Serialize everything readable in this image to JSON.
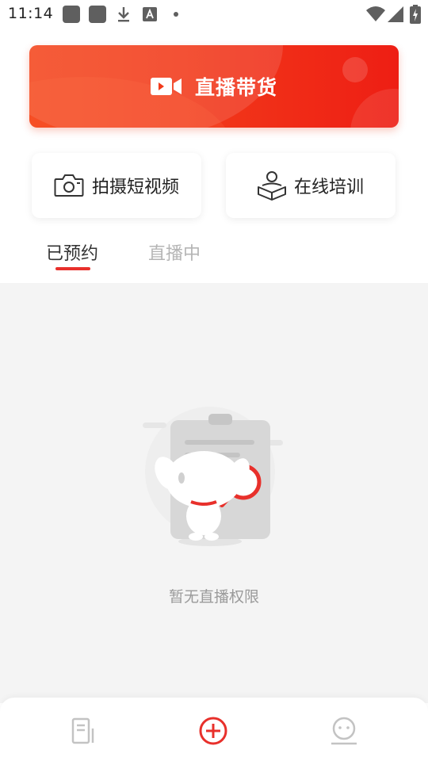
{
  "status_bar": {
    "time": "11:14",
    "icons": [
      "app-notification-icon",
      "app-notification-icon",
      "download-icon",
      "font-icon",
      "dot-icon",
      "wifi-icon",
      "signal-icon",
      "battery-charging-icon"
    ]
  },
  "banner": {
    "label": "直播带货",
    "icon": "video-camera-icon"
  },
  "features": [
    {
      "label": "拍摄短视频",
      "icon": "camera-icon"
    },
    {
      "label": "在线培训",
      "icon": "reading-person-icon"
    }
  ],
  "tabs": [
    {
      "label": "已预约",
      "active": true
    },
    {
      "label": "直播中",
      "active": false
    }
  ],
  "empty_state": {
    "message": "暂无直播权限",
    "icon": "empty-mascot-illustration"
  },
  "bottom_nav": [
    {
      "icon": "document-icon",
      "active": false
    },
    {
      "icon": "add-circle-icon",
      "active": true
    },
    {
      "icon": "profile-face-icon",
      "active": false
    }
  ],
  "colors": {
    "accent": "#e8302b",
    "banner_start": "#f4461d",
    "banner_end": "#ee1e14",
    "inactive_text": "#b5b5b5",
    "background_gray": "#f4f4f4"
  }
}
